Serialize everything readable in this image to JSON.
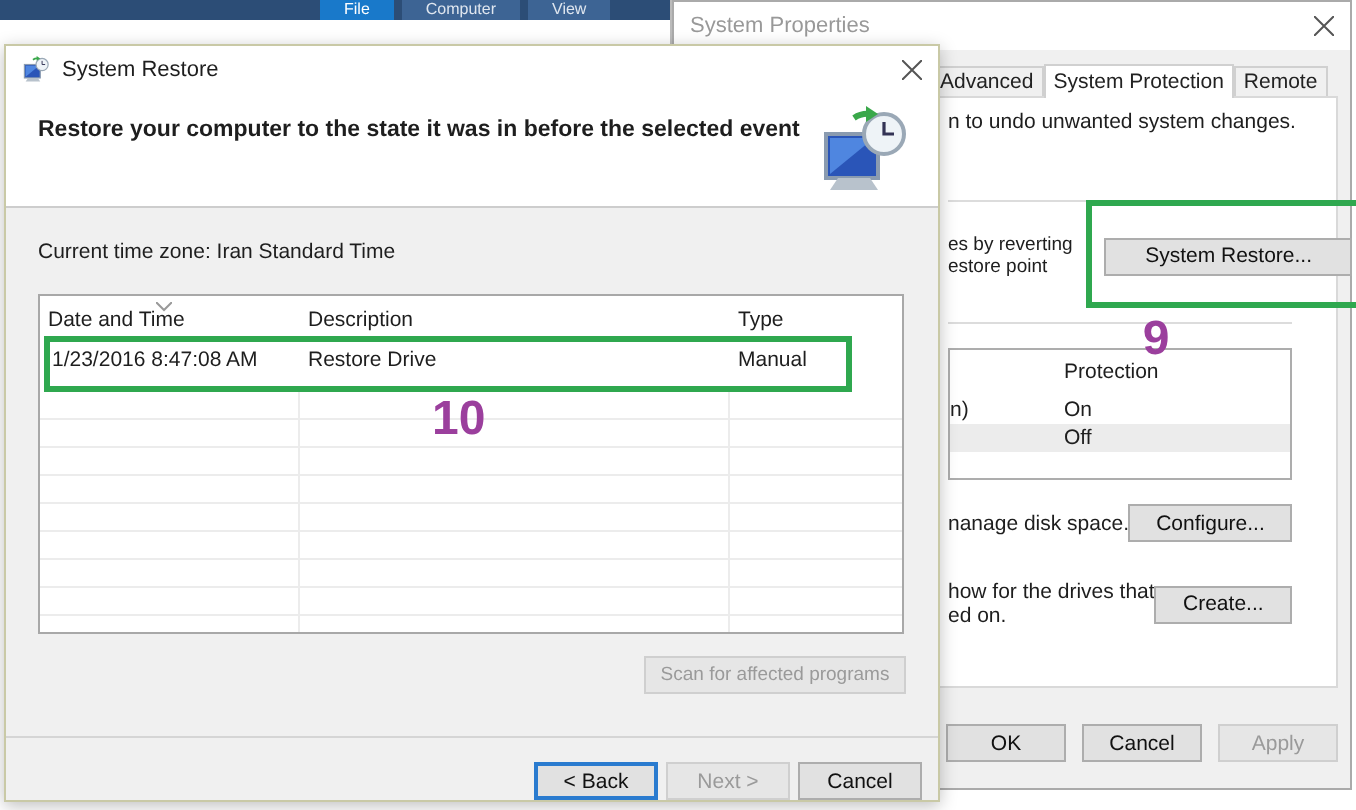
{
  "explorer_ribbon": {
    "tabs": [
      {
        "label": "File",
        "selected": true
      },
      {
        "label": "Computer",
        "selected": false
      },
      {
        "label": "View",
        "selected": false
      }
    ]
  },
  "system_properties": {
    "title": "System Properties",
    "tabs": [
      {
        "label": "Advanced",
        "selected": false
      },
      {
        "label": "System Protection",
        "selected": true
      },
      {
        "label": "Remote",
        "selected": false
      }
    ],
    "intro": "n to undo unwanted system changes.",
    "restore_text": [
      "es by reverting",
      "estore point"
    ],
    "restore_button": {
      "label": "System Restore...",
      "annotation": "9"
    },
    "drives_table": {
      "columns": [
        "Protection"
      ],
      "rows": [
        {
          "drive": "n)",
          "protection": "On",
          "selected": false
        },
        {
          "protection": "Off",
          "selected": true
        }
      ]
    },
    "configure_text": [
      "nanage disk space."
    ],
    "configure_button": "Configure...",
    "create_text": [
      "how for the drives that",
      "ed on."
    ],
    "create_button": "Create...",
    "buttons": [
      {
        "label": "OK",
        "disabled": false
      },
      {
        "label": "Cancel",
        "disabled": false
      },
      {
        "label": "Apply",
        "disabled": true
      }
    ]
  },
  "system_restore": {
    "title": "System Restore",
    "heading": "Restore your computer to the state it was in before the selected event",
    "time_zone": "Current time zone: Iran Standard Time",
    "table": {
      "columns": [
        "Date and Time",
        "Description",
        "Type"
      ],
      "rows": [
        {
          "cells": [
            "1/23/2016 8:47:08 AM",
            "Restore Drive",
            "Manual"
          ],
          "selected": false,
          "annotation": "10"
        }
      ]
    },
    "scan_button": {
      "label": "Scan for affected programs",
      "disabled": true
    },
    "buttons": [
      {
        "label": "< Back",
        "disabled": false,
        "focused": true
      },
      {
        "label": "Next >",
        "disabled": true,
        "focused": false
      },
      {
        "label": "Cancel",
        "disabled": false,
        "focused": false
      }
    ]
  }
}
